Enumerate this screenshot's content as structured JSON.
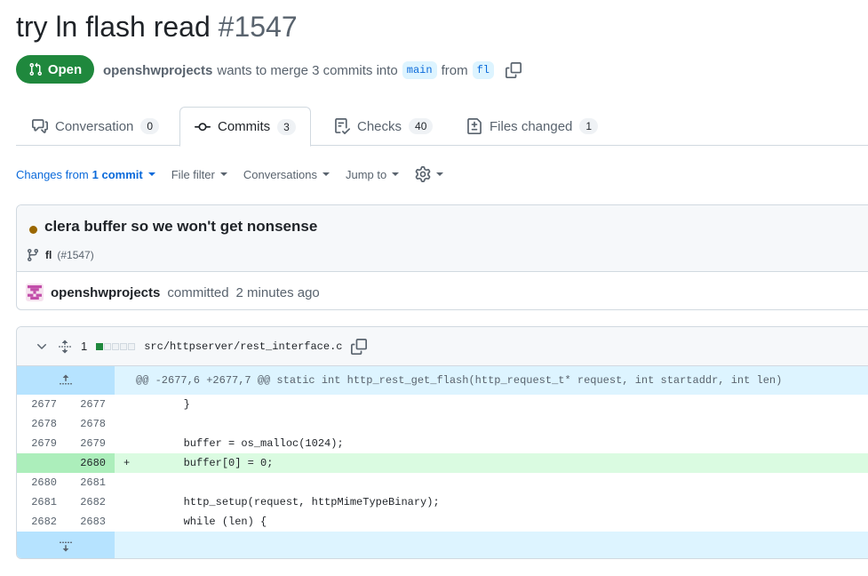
{
  "pr": {
    "title": "try ln flash read",
    "number": "#1547",
    "state": "Open",
    "author": "openshwprojects",
    "merge_text": "wants to merge 3 commits into",
    "base_branch": "main",
    "from_text": "from",
    "head_branch": "fl"
  },
  "tabs": [
    {
      "label": "Conversation",
      "count": "0"
    },
    {
      "label": "Commits",
      "count": "3"
    },
    {
      "label": "Checks",
      "count": "40"
    },
    {
      "label": "Files changed",
      "count": "1"
    }
  ],
  "toolbar": {
    "changes_prefix": "Changes from",
    "changes_value": "1 commit",
    "file_filter": "File filter",
    "conversations": "Conversations",
    "jump_to": "Jump to"
  },
  "commit": {
    "message": "clera buffer so we won't get nonsense",
    "branch": "fl",
    "pr_ref": "(#1547)",
    "author": "openshwprojects",
    "action": "committed",
    "time": "2 minutes ago"
  },
  "file": {
    "changes": "1",
    "name": "src/httpserver/rest_interface.c",
    "hunk": "@@ -2677,6 +2677,7 @@ static int http_rest_get_flash(http_request_t* request, int startaddr, int len)",
    "lines": [
      {
        "old": "2677",
        "new": "2677",
        "sign": "",
        "code": "        }"
      },
      {
        "old": "2678",
        "new": "2678",
        "sign": "",
        "code": ""
      },
      {
        "old": "2679",
        "new": "2679",
        "sign": "",
        "code": "        buffer = os_malloc(1024);"
      },
      {
        "old": "",
        "new": "2680",
        "sign": "+",
        "code": "        buffer[0] = 0;"
      },
      {
        "old": "2680",
        "new": "2681",
        "sign": "",
        "code": ""
      },
      {
        "old": "2681",
        "new": "2682",
        "sign": "",
        "code": "        http_setup(request, httpMimeTypeBinary);"
      },
      {
        "old": "2682",
        "new": "2683",
        "sign": "",
        "code": "        while (len) {"
      }
    ]
  },
  "colors": {
    "open_green": "#1f883d",
    "link_blue": "#0969da",
    "add_bg": "#dafbe1",
    "hunk_bg": "#ddf4ff"
  }
}
